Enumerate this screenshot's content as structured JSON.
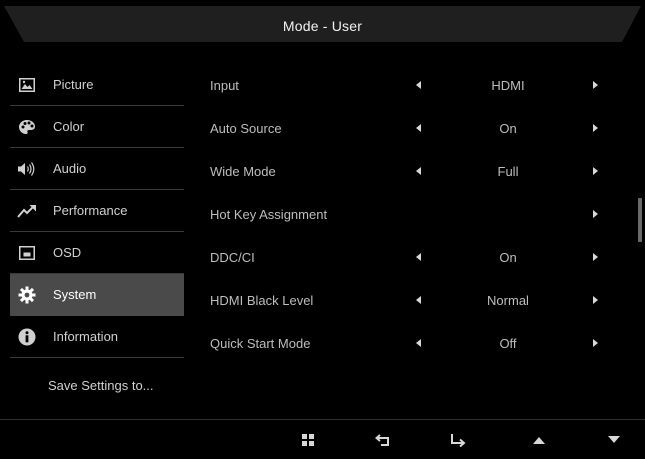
{
  "header": {
    "title": "Mode - User"
  },
  "sidebar": {
    "items": [
      {
        "label": "Picture",
        "icon": "picture-icon",
        "active": false
      },
      {
        "label": "Color",
        "icon": "palette-icon",
        "active": false
      },
      {
        "label": "Audio",
        "icon": "speaker-icon",
        "active": false
      },
      {
        "label": "Performance",
        "icon": "trend-up-icon",
        "active": false
      },
      {
        "label": "OSD",
        "icon": "osd-window-icon",
        "active": false
      },
      {
        "label": "System",
        "icon": "gear-icon",
        "active": true
      },
      {
        "label": "Information",
        "icon": "info-icon",
        "active": false
      }
    ],
    "save_label": "Save Settings to..."
  },
  "settings": [
    {
      "name": "Input",
      "value": "HDMI",
      "has_left_arrow": true,
      "has_right_arrow": true
    },
    {
      "name": "Auto Source",
      "value": "On",
      "has_left_arrow": true,
      "has_right_arrow": true
    },
    {
      "name": "Wide Mode",
      "value": "Full",
      "has_left_arrow": true,
      "has_right_arrow": true
    },
    {
      "name": "Hot Key Assignment",
      "value": "",
      "has_left_arrow": false,
      "has_right_arrow": true
    },
    {
      "name": "DDC/CI",
      "value": "On",
      "has_left_arrow": true,
      "has_right_arrow": true
    },
    {
      "name": "HDMI Black Level",
      "value": "Normal",
      "has_left_arrow": true,
      "has_right_arrow": true
    },
    {
      "name": "Quick Start Mode",
      "value": "Off",
      "has_left_arrow": true,
      "has_right_arrow": true
    }
  ],
  "footer": {
    "controls": [
      "menu-grid-icon",
      "back-icon",
      "enter-icon",
      "up-triangle-icon",
      "down-triangle-icon"
    ]
  },
  "colors": {
    "background": "#000000",
    "header_panel": "#1f1f1f",
    "active_item": "#4a4a4a",
    "text": "#c9c9c9",
    "separator": "#3a3a3a"
  }
}
